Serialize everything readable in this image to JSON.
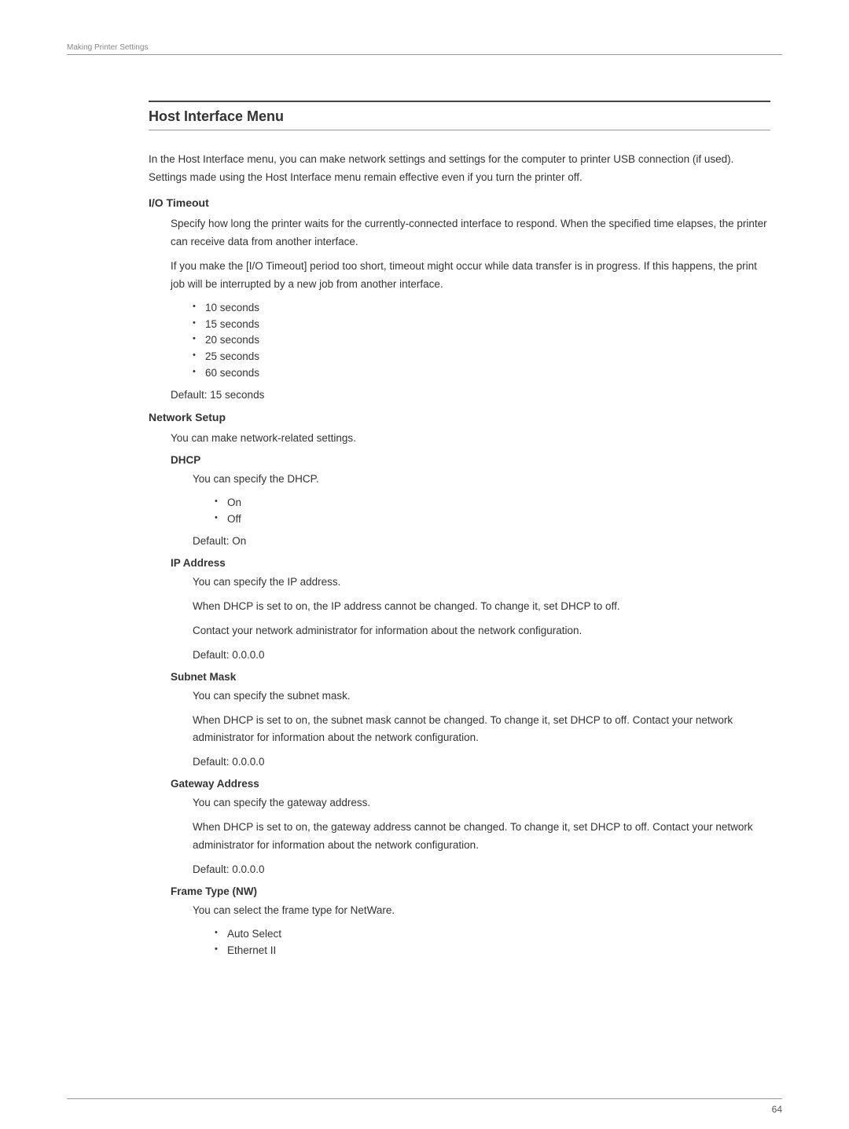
{
  "header": {
    "breadcrumb": "Making Printer Settings"
  },
  "title": "Host Interface Menu",
  "intro": "In the Host Interface menu, you can make network settings and settings for the computer to printer USB connection (if used). Settings made using the Host Interface menu remain effective even if you turn the printer off.",
  "io_timeout": {
    "heading": "I/O Timeout",
    "p1": "Specify how long the printer waits for the currently-connected interface to respond. When the specified time elapses, the printer can receive data from another interface.",
    "p2": "If you make the [I/O Timeout] period too short, timeout might occur while data transfer is in progress. If this happens, the print job will be interrupted by a new job from another interface.",
    "options": [
      "10 seconds",
      "15 seconds",
      "20 seconds",
      "25 seconds",
      "60 seconds"
    ],
    "default": "Default: 15 seconds"
  },
  "network_setup": {
    "heading": "Network Setup",
    "p1": "You can make network-related settings.",
    "dhcp": {
      "label": "DHCP",
      "p1": "You can specify the DHCP.",
      "options": [
        "On",
        "Off"
      ],
      "default": "Default: On"
    },
    "ip_address": {
      "label": "IP Address",
      "p1": "You can specify the IP address.",
      "p2": "When DHCP is set to on, the IP address cannot be changed. To change it, set DHCP to off.",
      "p3": "Contact your network administrator for information about the network configuration.",
      "default": "Default: 0.0.0.0"
    },
    "subnet_mask": {
      "label": "Subnet Mask",
      "p1": "You can specify the subnet mask.",
      "p2": "When DHCP is set to on, the subnet mask cannot be changed. To change it, set DHCP to off. Contact your network administrator for information about the network configuration.",
      "default": "Default: 0.0.0.0"
    },
    "gateway": {
      "label": "Gateway Address",
      "p1": "You can specify the gateway address.",
      "p2": "When DHCP is set to on, the gateway address cannot be changed. To change it, set DHCP to off. Contact your network administrator for information about the network configuration.",
      "default": "Default: 0.0.0.0"
    },
    "frame_type": {
      "label": "Frame Type (NW)",
      "p1": "You can select the frame type for NetWare.",
      "options": [
        "Auto Select",
        "Ethernet II"
      ]
    }
  },
  "page_number": "64"
}
